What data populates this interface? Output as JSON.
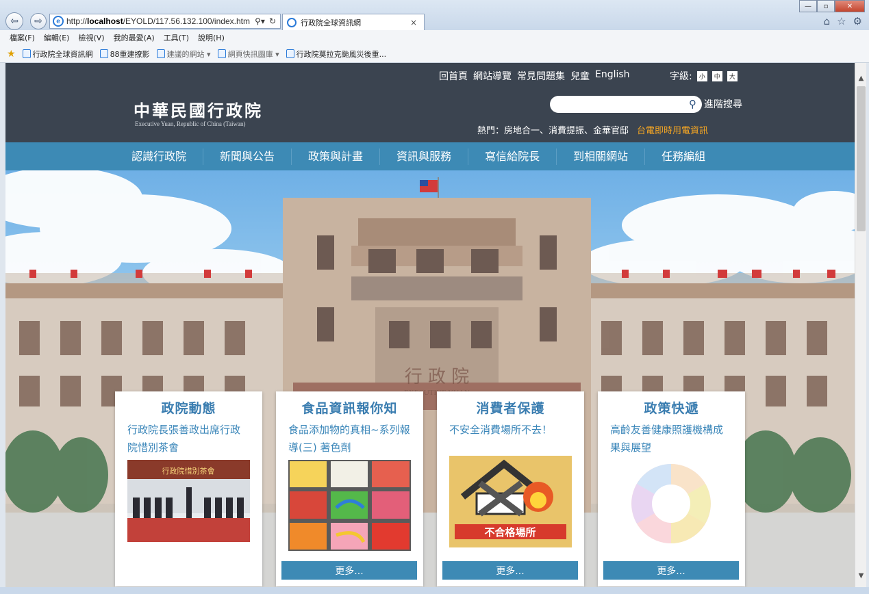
{
  "browser": {
    "address_prefix": "http://",
    "address_host": "localhost",
    "address_path": "/EYOLD/117.56.132.100/index.htm",
    "tab_title": "行政院全球資訊網",
    "menu": [
      "檔案(F)",
      "編輯(E)",
      "檢視(V)",
      "我的最愛(A)",
      "工具(T)",
      "說明(H)"
    ],
    "favorites": [
      {
        "label": "行政院全球資訊網",
        "dim": false
      },
      {
        "label": "88重建撩影",
        "dim": false
      },
      {
        "label": "建議的網站 ▾",
        "dim": true
      },
      {
        "label": "網頁快訊圖庫 ▾",
        "dim": true
      },
      {
        "label": "行政院莫拉克颱風災後重...",
        "dim": false
      }
    ]
  },
  "site": {
    "util_nav": [
      "回首頁",
      "網站導覽",
      "常見問題集",
      "兒童",
      "English"
    ],
    "font_size_label": "字級:",
    "font_sizes": [
      "小",
      "中",
      "大"
    ],
    "logo_zh": "中華民國行政院",
    "logo_en": "Executive Yuan, Republic of China (Taiwan)",
    "search_placeholder": "",
    "advanced_search": "進階搜尋",
    "hot_label": "熱門：房地合一、消費提振、金華官邸",
    "hot_highlight": "台電即時用電資訊",
    "main_nav": [
      "認識行政院",
      "新聞與公告",
      "政策與計畫",
      "資訊與服務",
      "寫信給院長",
      "到相關網站",
      "任務編組"
    ],
    "hero_sign": "行 政 院",
    "hero_sign_en": "EXECUTIVE YUAN"
  },
  "cards": [
    {
      "title": "政院動態",
      "subtitle": "行政院長張善政出席行政院惜別茶會",
      "image_caption": "行政院惜別茶會",
      "more": ""
    },
    {
      "title": "食品資訊報你知",
      "subtitle": "食品添加物的真相~系列報導(三) 著色劑",
      "image_caption": "",
      "more": "更多..."
    },
    {
      "title": "消費者保護",
      "subtitle": "不安全消費場所不去！",
      "image_caption": "不合格場所",
      "more": "更多..."
    },
    {
      "title": "政策快遞",
      "subtitle": "高齡友善健康照護機構成果與展望",
      "image_caption": "",
      "more": "更多..."
    }
  ],
  "colors": {
    "header_dark": "#3b4450",
    "nav_blue": "#3d8ab5",
    "card_title": "#3a7db0",
    "hot_highlight": "#f5a623"
  }
}
